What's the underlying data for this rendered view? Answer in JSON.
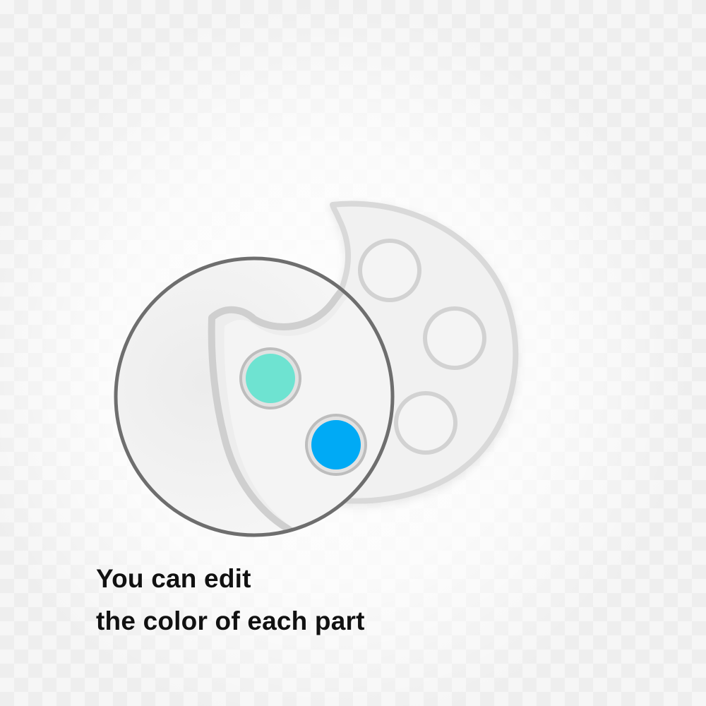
{
  "caption": {
    "line1": "You can edit",
    "line2": "the color of each part"
  },
  "colors": {
    "background": "#f6f6f6",
    "palette_fill": "#f1f1f1",
    "palette_stroke": "#d9d9d9",
    "lens_ring": "#6e6e6e",
    "well_1": "#6ee3d1",
    "well_2": "#00aaf5",
    "text": "#111111"
  },
  "icons": [
    "paint-palette-icon",
    "magnifier-lens-icon"
  ]
}
